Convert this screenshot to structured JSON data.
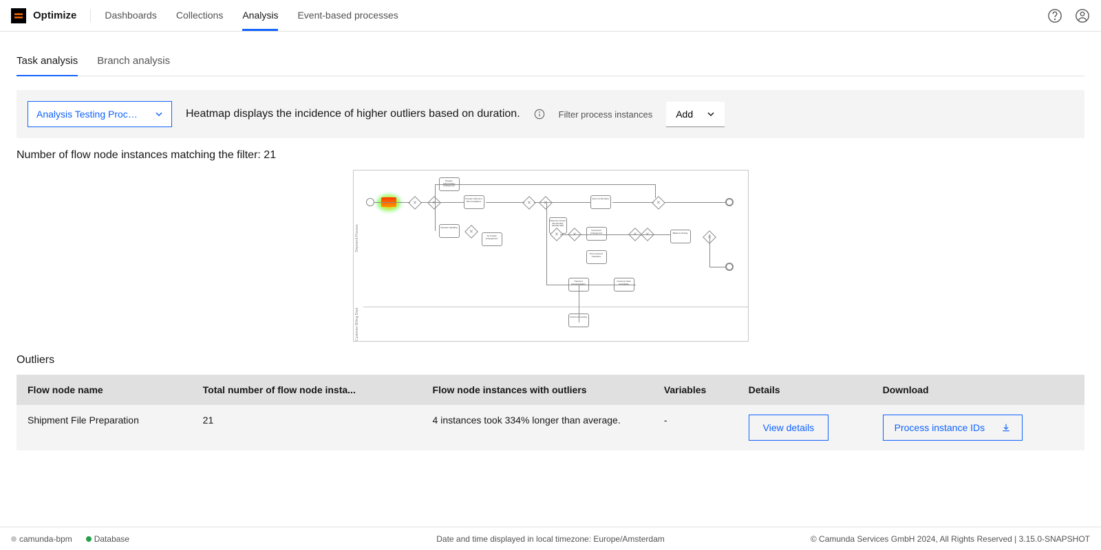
{
  "header": {
    "product": "Optimize",
    "nav": [
      "Dashboards",
      "Collections",
      "Analysis",
      "Event-based processes"
    ],
    "active_nav": 2
  },
  "tabs": {
    "items": [
      "Task analysis",
      "Branch analysis"
    ],
    "active": 0
  },
  "panel": {
    "process_label": "Analysis Testing Proce...",
    "description": "Heatmap displays the incidence of higher outliers based on duration.",
    "filter_label": "Filter process instances",
    "add_label": "Add"
  },
  "count_line": "Number of flow node instances matching the filter: 21",
  "outliers_heading": "Outliers",
  "table": {
    "headers": [
      "Flow node name",
      "Total number of flow node insta...",
      "Flow node instances with outliers",
      "Variables",
      "Details",
      "Download"
    ],
    "rows": [
      {
        "name": "Shipment File Preparation",
        "total": "21",
        "outliers_text": "4 instances took 334% longer than average.",
        "variables": "-",
        "details_btn": "View details",
        "download_btn": "Process instance IDs"
      }
    ]
  },
  "footer": {
    "engine": "camunda-bpm",
    "db": "Database",
    "tz": "Date and time displayed in local timezone: Europe/Amsterdam",
    "copyright": "© Camunda Services GmbH 2024, All Rights Reserved | 3.15.0-SNAPSHOT"
  },
  "bpmn_nodes": {
    "task_labels": [
      "Prepare Authorization Arrangement",
      "Prepare Shipment File Compliance",
      "Decision Handling",
      "Air Freight Arrangement",
      "Close Confirmation",
      "Shipment Transit Should Ship Already Start",
      "Investment Arrangement",
      "Post Customer Clearance",
      "Transport Documentation",
      "Invoice Accounting",
      "Customer Data Completion",
      "Balance Closing"
    ]
  }
}
